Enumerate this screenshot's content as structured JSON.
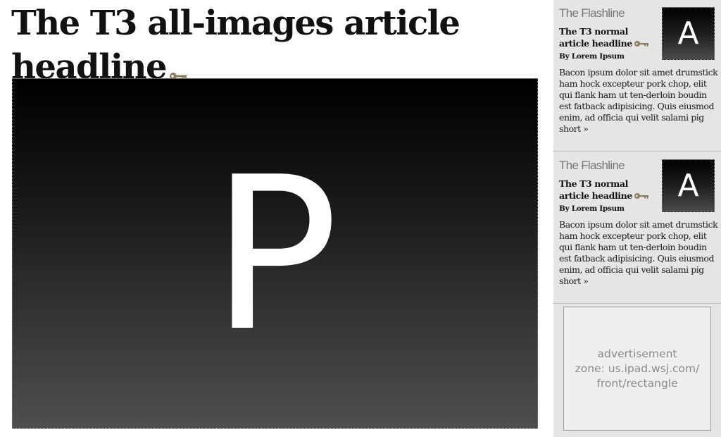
{
  "article": {
    "headline": "The T3 all-images article headline",
    "hero_image_letter": "P",
    "key_icon": "key-icon",
    "key_color": "#8b7d5e"
  },
  "sidebar": {
    "teasers": [
      {
        "section": "The Flashline",
        "headline": "The T3 normal article headline",
        "byline": "By Lorem Ipsum",
        "summary": "Bacon ipsum dolor sit amet drumstick ham hock excepteur pork chop, elit qui flank ham ut ten-derloin boudin est fatback adipisicing. Quis eiusmod enim, ad officia qui velit salami pig short »",
        "thumb_letter": "A"
      },
      {
        "section": "The Flashline",
        "headline": "The T3 normal article headline",
        "byline": "By Lorem Ipsum",
        "summary": "Bacon ipsum dolor sit amet drumstick ham hock excepteur pork chop, elit qui flank ham ut ten-derloin boudin est fatback adipisicing. Quis eiusmod enim, ad officia qui velit salami pig short »",
        "thumb_letter": "A"
      }
    ],
    "advertisement": {
      "line1": "advertisement",
      "line2": "zone: us.ipad.wsj.com/",
      "line3": "front/rectangle"
    }
  },
  "colors": {
    "sidebar_bg": "#e5e5e5",
    "section_label": "#777777",
    "ad_text": "#8a8a8a"
  }
}
